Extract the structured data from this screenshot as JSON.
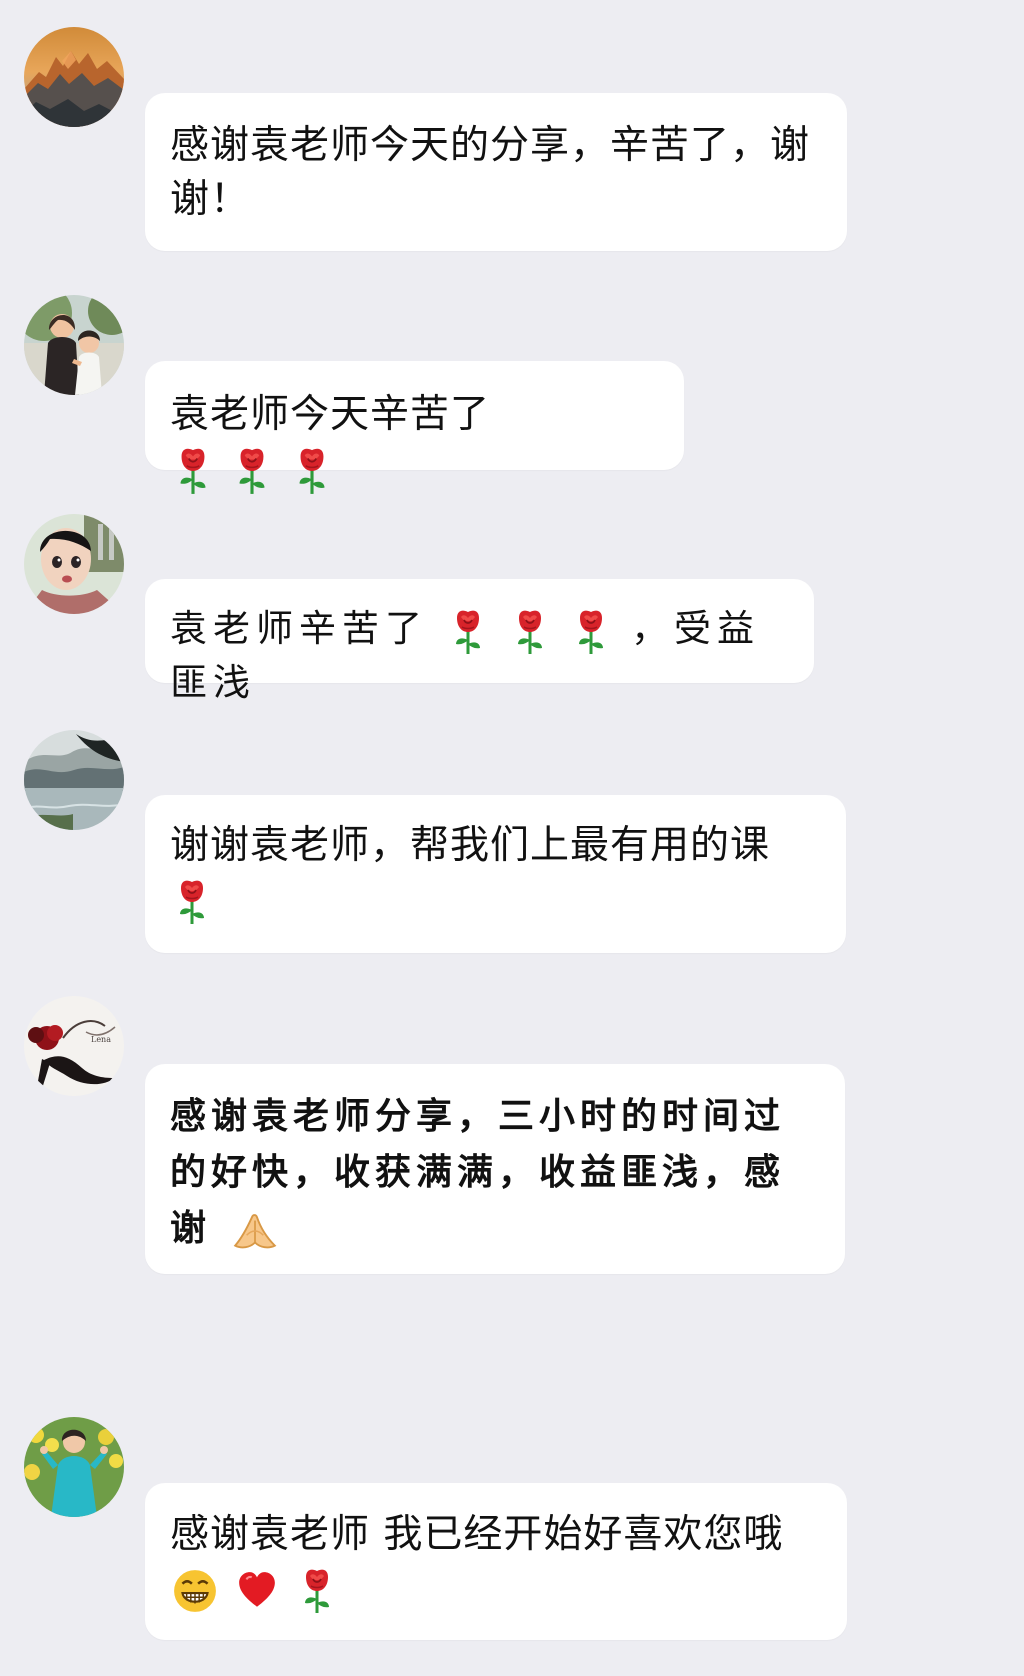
{
  "messages": [
    {
      "avatar": "mountain-sunset-avatar",
      "text": "感谢袁老师今天的分享，辛苦了，谢谢！",
      "emojis": []
    },
    {
      "avatar": "mother-child-avatar",
      "text": "袁老师今天辛苦了",
      "emojis": [
        "rose-icon",
        "rose-icon",
        "rose-icon"
      ]
    },
    {
      "avatar": "child-face-avatar",
      "text": "袁老师辛苦了",
      "emojis": [
        "rose-icon",
        "rose-icon",
        "rose-icon"
      ],
      "suffix": "，受益匪浅"
    },
    {
      "avatar": "lake-landscape-avatar",
      "text": "谢谢袁老师，帮我们上最有用的课",
      "emojis": [
        "rose-icon"
      ]
    },
    {
      "avatar": "high-heel-shoe-avatar",
      "text": "感谢袁老师分享，三小时的时间过的好快，收获满满，收益匪浅，感谢",
      "emojis": [
        "praying-hands-icon"
      ]
    },
    {
      "avatar": "woman-flower-field-avatar",
      "text": "感谢袁老师  我已经开始好喜欢您哦",
      "emojis": [
        "grinning-face-icon",
        "red-heart-icon",
        "rose-icon"
      ]
    }
  ],
  "colors": {
    "background": "#ededf2",
    "bubble": "#ffffff",
    "rose_red": "#d8232a",
    "rose_stem": "#2e9a3a",
    "heart_red": "#e31b23",
    "emoji_yellow": "#f7c431"
  }
}
